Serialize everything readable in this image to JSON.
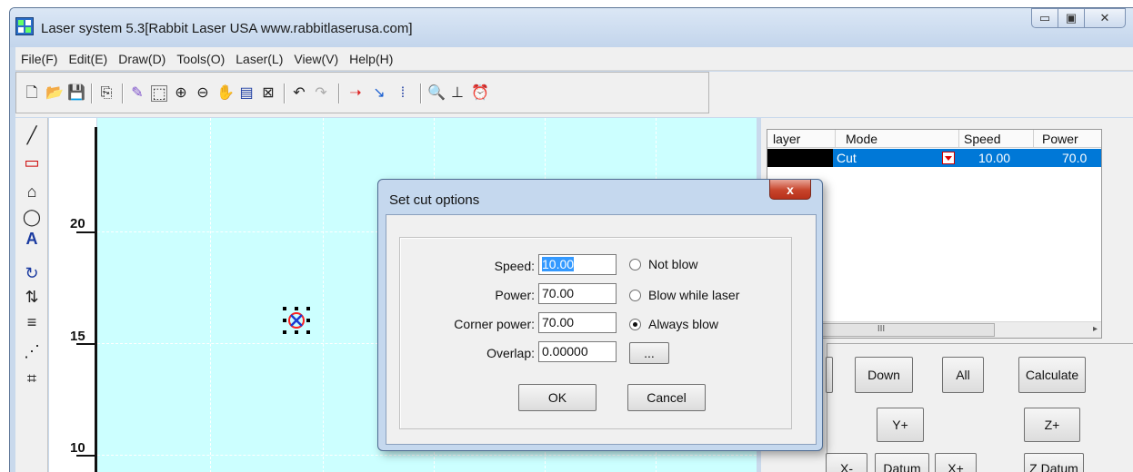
{
  "window": {
    "title": "Laser system 5.3[Rabbit Laser USA www.rabbitlaserusa.com]",
    "minimize_icon": "▭",
    "maximize_icon": "▣",
    "close_icon": "✕"
  },
  "menu": [
    "File(F)",
    "Edit(E)",
    "Draw(D)",
    "Tools(O)",
    "Laser(L)",
    "View(V)",
    "Help(H)"
  ],
  "ruler": {
    "labels": [
      "20",
      "15",
      "10"
    ]
  },
  "layer_table": {
    "headers": [
      "layer",
      "Mode",
      "Speed",
      "Power"
    ],
    "rows": [
      {
        "color": "#000000",
        "mode": "Cut",
        "speed": "10.00",
        "power": "70.0"
      }
    ],
    "scroll_thumb": "III",
    "scroll_arrow": "▸"
  },
  "controls": {
    "down": "Down",
    "all": "All",
    "calculate": "Calculate",
    "y_plus": "Y+",
    "z_plus": "Z+",
    "x_minus": "X-",
    "datum": "Datum",
    "x_plus": "X+",
    "z_datum": "Z Datum"
  },
  "dialog": {
    "title": "Set cut options",
    "close_icon": "x",
    "speed_label": "Speed:",
    "speed_value": "10.00",
    "power_label": "Power:",
    "power_value": "70.00",
    "corner_power_label": "Corner power:",
    "corner_power_value": "70.00",
    "overlap_label": "Overlap:",
    "overlap_value": "0.00000",
    "ellipsis_button": "...",
    "radio_options": [
      {
        "label": "Not blow",
        "selected": false
      },
      {
        "label": "Blow while laser",
        "selected": false
      },
      {
        "label": "Always blow",
        "selected": true
      }
    ],
    "ok_label": "OK",
    "cancel_label": "Cancel"
  },
  "colors": {
    "canvas_bg": "#ccffff",
    "selection_blue": "#0078d7",
    "dialog_frame": "#c5d8ee"
  }
}
